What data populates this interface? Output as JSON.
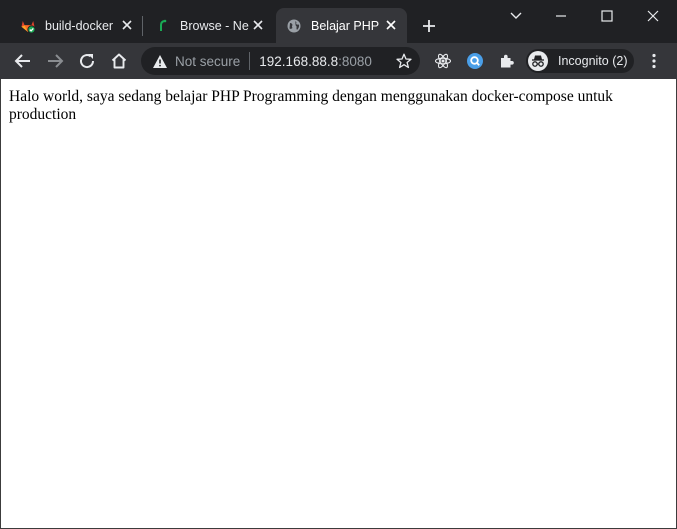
{
  "tabs": [
    {
      "title": "build-docker",
      "icon": "gitlab-fox-icon"
    },
    {
      "title": "Browse - Ne",
      "icon": "nexus-icon"
    },
    {
      "title": "Belajar PHP",
      "icon": "globe-icon"
    }
  ],
  "address": {
    "security_label": "Not secure",
    "host": "192.168.88.8",
    "port": ":8080"
  },
  "profile": {
    "label": "Incognito (2)"
  },
  "page": {
    "text": "Halo world, saya sedang belajar PHP Programming dengan menggunakan docker-compose untuk production"
  },
  "colors": {
    "frame": "#202124",
    "toolbar": "#35363a",
    "text_light": "#e8eaed",
    "muted": "#9aa0a6"
  }
}
